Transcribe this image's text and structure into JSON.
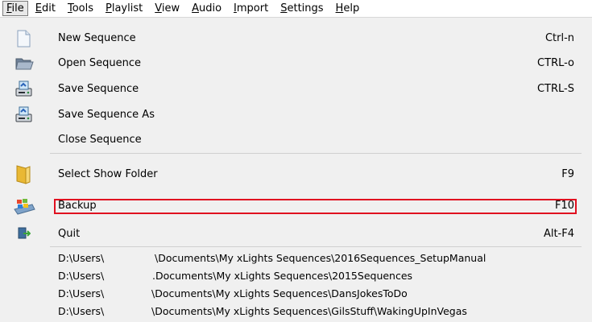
{
  "menubar": {
    "items": [
      {
        "label": "File",
        "accel": "F"
      },
      {
        "label": "Edit",
        "accel": "E"
      },
      {
        "label": "Tools",
        "accel": "T"
      },
      {
        "label": "Playlist",
        "accel": "P"
      },
      {
        "label": "View",
        "accel": "V"
      },
      {
        "label": "Audio",
        "accel": "A"
      },
      {
        "label": "Import",
        "accel": "I"
      },
      {
        "label": "Settings",
        "accel": "S"
      },
      {
        "label": "Help",
        "accel": "H"
      }
    ]
  },
  "file_menu": {
    "items": [
      {
        "label": "New Sequence",
        "shortcut": "Ctrl-n",
        "icon": "new-document-icon"
      },
      {
        "label": "Open Sequence",
        "shortcut": "CTRL-o",
        "icon": "open-folder-icon"
      },
      {
        "label": "Save Sequence",
        "shortcut": "CTRL-S",
        "icon": "save-drive-icon"
      },
      {
        "label": "Save Sequence As",
        "shortcut": "",
        "icon": "save-as-drive-icon"
      },
      {
        "label": "Close Sequence",
        "shortcut": "",
        "icon": ""
      },
      {
        "label": "Select Show Folder",
        "shortcut": "F9",
        "icon": "yellow-folder-icon"
      },
      {
        "label": "Backup",
        "shortcut": "F10",
        "icon": "windows-backup-icon"
      },
      {
        "label": "Quit",
        "shortcut": "Alt-F4",
        "icon": "exit-icon"
      }
    ],
    "recent": [
      {
        "prefix": "D:\\Users\\",
        "suffix": "\\Documents\\My xLights Sequences\\2016Sequences_SetupManual"
      },
      {
        "prefix": "D:\\Users\\",
        "suffix": ".Documents\\My xLights Sequences\\2015Sequences"
      },
      {
        "prefix": "D:\\Users\\",
        "suffix": "\\Documents\\My xLights Sequences\\DansJokesToDo"
      },
      {
        "prefix": "D:\\Users\\",
        "suffix": "\\Documents\\My xLights Sequences\\GilsStuff\\WakingUpInVegas"
      }
    ]
  },
  "colors": {
    "menu_bg": "#f0f0f0",
    "highlight_border": "#e01020"
  }
}
